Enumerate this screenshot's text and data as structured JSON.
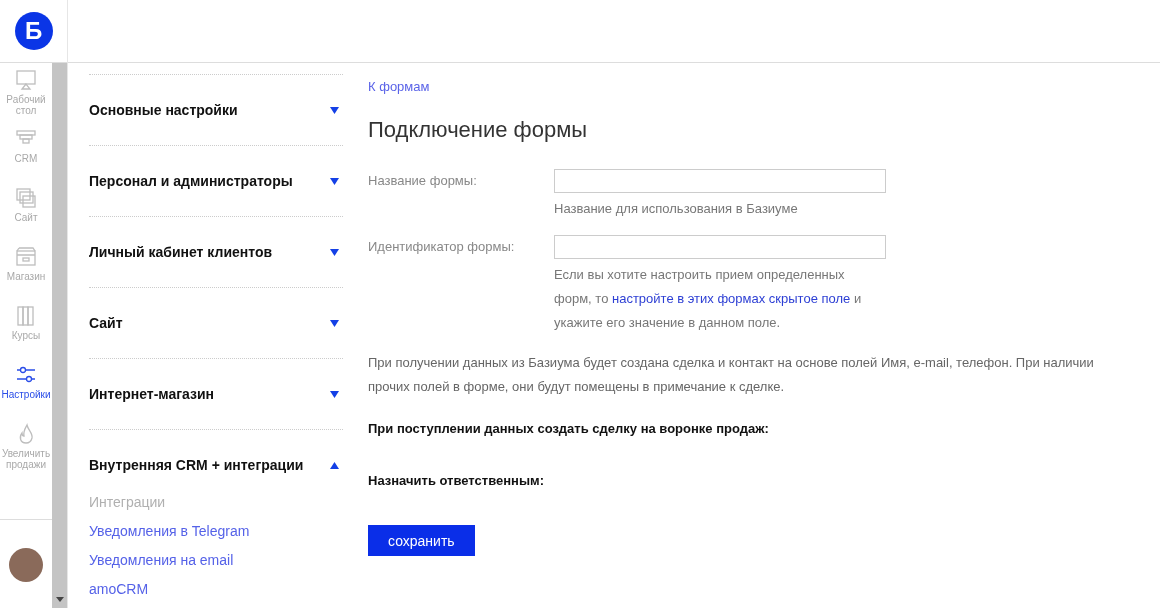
{
  "logo": {
    "letter": "Б"
  },
  "nav": [
    {
      "label": "Рабочий стол",
      "selected": false
    },
    {
      "label": "CRM",
      "selected": false
    },
    {
      "label": "Сайт",
      "selected": false
    },
    {
      "label": "Магазин",
      "selected": false
    },
    {
      "label": "Курсы",
      "selected": false
    },
    {
      "label": "Настройки",
      "selected": true
    },
    {
      "label": "Увеличить продажи",
      "selected": false
    }
  ],
  "sections": [
    {
      "title": "Основные настройки",
      "expanded": false
    },
    {
      "title": "Персонал и администраторы",
      "expanded": false
    },
    {
      "title": "Личный кабинет клиентов",
      "expanded": false
    },
    {
      "title": "Сайт",
      "expanded": false
    },
    {
      "title": "Интернет-магазин",
      "expanded": false
    },
    {
      "title": "Внутренняя CRM + интеграции",
      "expanded": true,
      "children": [
        {
          "label": "Интеграции",
          "selected": true
        },
        {
          "label": "Уведомления в Telegram",
          "selected": false
        },
        {
          "label": "Уведомления на email",
          "selected": false
        },
        {
          "label": "amoCRM",
          "selected": false
        }
      ]
    }
  ],
  "back_link": "К формам",
  "title": "Подключение формы",
  "fields": [
    {
      "label": "Название формы:",
      "help": {
        "before": "Название для использования в Базиуме"
      }
    },
    {
      "label": "Идентификатор формы:",
      "help": {
        "before": "Если вы хотите настроить прием определенных форм, то",
        "link": "настройте в этих формах скрытое поле",
        "after": "и укажите его значение в данном поле."
      }
    }
  ],
  "note": "При получении данных из Базиума будет создана сделка и контакт на основе полей Имя, e-mail, телефон. При наличии прочих полей в форме, они будут помещены в примечание к сделке.",
  "headings": [
    "При поступлении данных создать сделку на воронке продаж:",
    "Назначить ответственным:"
  ],
  "save_button": "сохранить"
}
